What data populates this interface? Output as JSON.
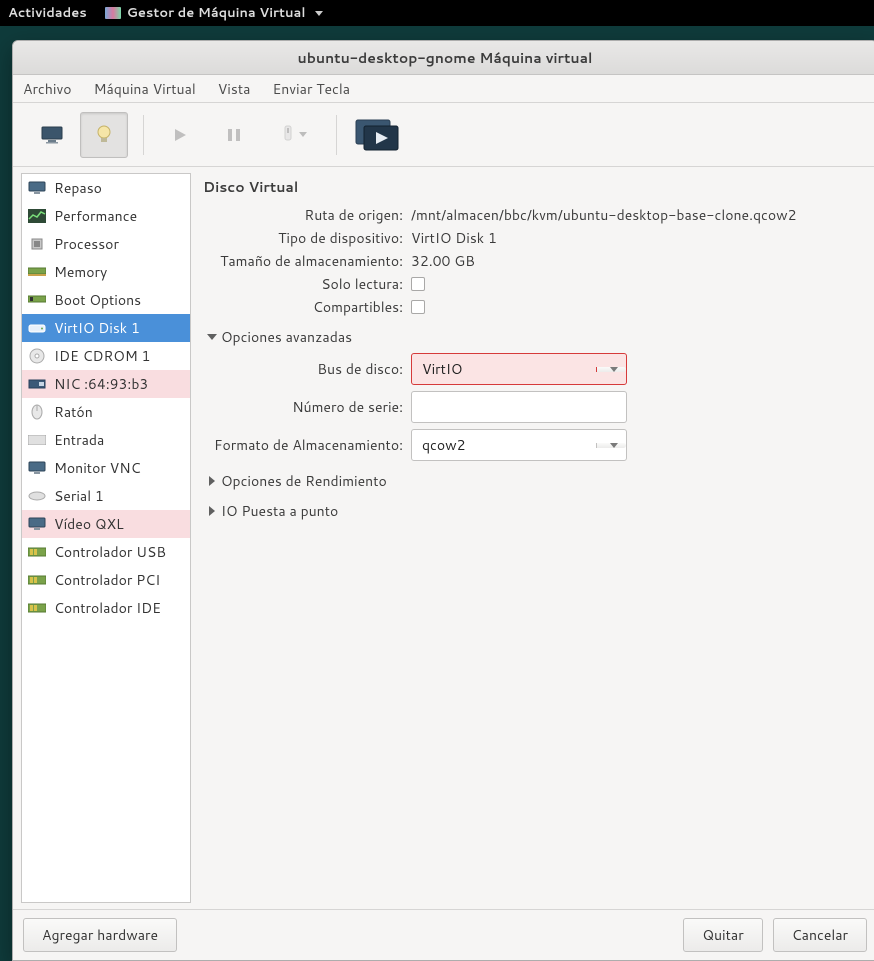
{
  "gnome": {
    "activities": "Actividades",
    "app_title": "Gestor de Máquina Virtual"
  },
  "window": {
    "title": "ubuntu-desktop-gnome Máquina virtual"
  },
  "menubar": {
    "file": "Archivo",
    "vm": "Máquina Virtual",
    "view": "Vista",
    "sendkey": "Enviar Tecla"
  },
  "sidebar": [
    {
      "id": "repaso",
      "label": "Repaso",
      "icon": "monitor",
      "selected": false,
      "pink": false
    },
    {
      "id": "performance",
      "label": "Performance",
      "icon": "chart",
      "selected": false,
      "pink": false
    },
    {
      "id": "processor",
      "label": "Processor",
      "icon": "cpu",
      "selected": false,
      "pink": false
    },
    {
      "id": "memory",
      "label": "Memory",
      "icon": "ram",
      "selected": false,
      "pink": false
    },
    {
      "id": "boot",
      "label": "Boot Options",
      "icon": "boot",
      "selected": false,
      "pink": false
    },
    {
      "id": "virtio-disk-1",
      "label": "VirtIO Disk 1",
      "icon": "hdd",
      "selected": true,
      "pink": false
    },
    {
      "id": "ide-cdrom-1",
      "label": "IDE CDROM 1",
      "icon": "cd",
      "selected": false,
      "pink": false
    },
    {
      "id": "nic",
      "label": "NIC :64:93:b3",
      "icon": "nic",
      "selected": false,
      "pink": true
    },
    {
      "id": "raton",
      "label": "Ratón",
      "icon": "mouse",
      "selected": false,
      "pink": false
    },
    {
      "id": "entrada",
      "label": "Entrada",
      "icon": "keyboard",
      "selected": false,
      "pink": false
    },
    {
      "id": "monitor-vnc",
      "label": "Monitor VNC",
      "icon": "monitor",
      "selected": false,
      "pink": false
    },
    {
      "id": "serial-1",
      "label": "Serial 1",
      "icon": "serial",
      "selected": false,
      "pink": false
    },
    {
      "id": "video-qxl",
      "label": "Vídeo QXL",
      "icon": "video",
      "selected": false,
      "pink": true
    },
    {
      "id": "usb-ctrl",
      "label": "Controlador USB",
      "icon": "ctrl",
      "selected": false,
      "pink": false
    },
    {
      "id": "pci-ctrl",
      "label": "Controlador PCI",
      "icon": "ctrl",
      "selected": false,
      "pink": false
    },
    {
      "id": "ide-ctrl",
      "label": "Controlador IDE",
      "icon": "ctrl",
      "selected": false,
      "pink": false
    }
  ],
  "content": {
    "title": "Disco Virtual",
    "labels": {
      "source_path": "Ruta de origen:",
      "device_type": "Tipo de dispositivo:",
      "storage_size": "Tamaño de almacenamiento:",
      "readonly": "Solo lectura:",
      "shareable": "Compartibles:",
      "disk_bus": "Bus de disco:",
      "serial": "Número de serie:",
      "storage_format": "Formato de Almacenamiento:"
    },
    "values": {
      "source_path": "/mnt/almacen/bbc/kvm/ubuntu-desktop-base-clone.qcow2",
      "device_type": "VirtIO Disk 1",
      "storage_size": "32.00 GB",
      "readonly_checked": false,
      "shareable_checked": false,
      "disk_bus": "VirtIO",
      "serial": "",
      "storage_format": "qcow2"
    },
    "expanders": {
      "advanced": "Opciones avanzadas",
      "performance": "Opciones de Rendimiento",
      "io_tuning": "IO Puesta a punto"
    }
  },
  "footer": {
    "add_hardware": "Agregar hardware",
    "remove": "Quitar",
    "cancel": "Cancelar"
  }
}
